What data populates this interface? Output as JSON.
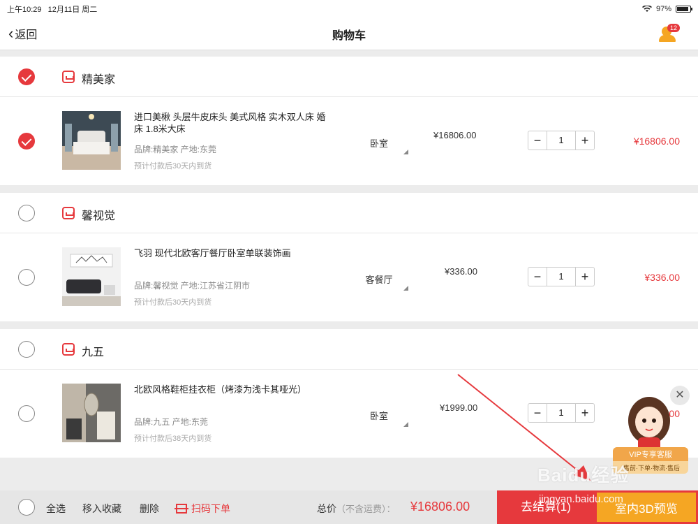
{
  "status_bar": {
    "time": "上午10:29",
    "date": "12月11日 周二",
    "battery": "97%"
  },
  "nav": {
    "back_label": "返回",
    "title": "购物车",
    "service_badge": "12"
  },
  "shops": [
    {
      "name": "精美家",
      "checked": true,
      "item": {
        "title": "进口美楸 头层牛皮床头 美式风格 实木双人床 婚床 1.8米大床",
        "meta": "品牌:精美家 产地:东莞",
        "eta": "预计付款后30天内到货",
        "room": "卧室",
        "unit_price": "¥16806.00",
        "qty": "1",
        "subtotal": "¥16806.00",
        "checked": true
      }
    },
    {
      "name": "馨视觉",
      "checked": false,
      "item": {
        "title": "飞羽 现代北欧客厅餐厅卧室单联装饰画",
        "meta": "品牌:馨视觉 产地:江苏省江阴市",
        "eta": "预计付款后30天内到货",
        "room": "客餐厅",
        "unit_price": "¥336.00",
        "qty": "1",
        "subtotal": "¥336.00",
        "checked": false
      }
    },
    {
      "name": "九五",
      "checked": false,
      "item": {
        "title": "北欧风格鞋柜挂衣柜（烤漆为浅卡其哑光）",
        "meta": "品牌:九五 产地:东莞",
        "eta": "预计付款后38天内到货",
        "room": "卧室",
        "unit_price": "¥1999.00",
        "qty": "1",
        "subtotal": "9.00",
        "checked": false
      }
    }
  ],
  "stepper": {
    "minus": "−",
    "plus": "+"
  },
  "bottom": {
    "select_all": "全选",
    "favorite": "移入收藏",
    "delete": "删除",
    "scan": "扫码下单",
    "total_label": "总价",
    "total_note": "（不含运费）：",
    "total_value": "¥16806.00",
    "checkout": "去结算(1)",
    "preview_3d": "室内3D预览"
  },
  "assistant": {
    "vip_title": "VIP专享客服",
    "vip_sub": "·售前·下单·物流·售后",
    "close": "✕"
  },
  "watermark": {
    "logo": "Baidu经验",
    "url": "jingyan.baidu.com"
  },
  "colors": {
    "accent": "#e6393d",
    "orange": "#f5a623"
  }
}
